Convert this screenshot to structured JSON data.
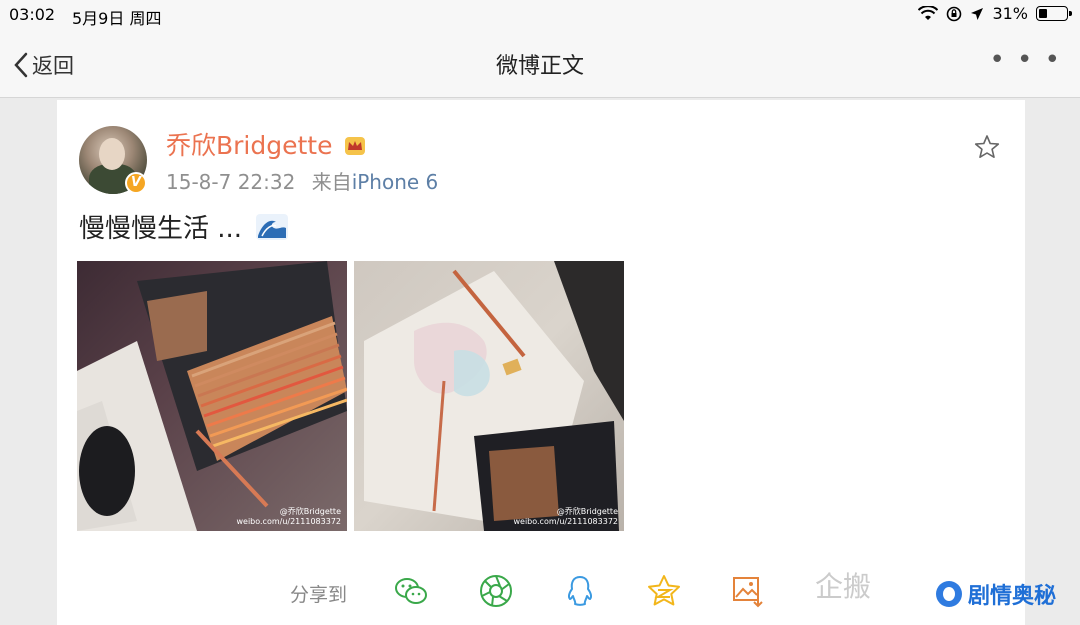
{
  "status_bar": {
    "time": "03:02",
    "date": "5月9日 周四",
    "battery": "31%",
    "battery_level": 0.31
  },
  "nav": {
    "back_label": "返回",
    "title": "微博正文",
    "more": "• • •"
  },
  "post": {
    "username": "乔欣Bridgette",
    "timestamp": "15-8-7 22:32",
    "source_prefix": "来自",
    "source": "iPhone 6",
    "text": "慢慢慢生活 ...",
    "verified_badge": "V",
    "images": [
      {
        "watermark_line1": "@乔欣Bridgette",
        "watermark_line2": "weibo.com/u/2111083372"
      },
      {
        "watermark_line1": "@乔欣Bridgette",
        "watermark_line2": "weibo.com/u/2111083372"
      }
    ]
  },
  "share": {
    "label": "分享到",
    "icons": [
      "wechat-icon",
      "moments-icon",
      "qq-icon",
      "qzone-icon",
      "save-image-icon"
    ]
  },
  "overlay": {
    "faded_text": "企搬",
    "brand_text": "剧情奥秘"
  },
  "colors": {
    "username": "#eb7350",
    "link": "#5d7fa6",
    "share_icon": "#3aa84a",
    "qq": "#3b9ae1",
    "qzone": "#f2b61b",
    "save": "#e4833a"
  }
}
